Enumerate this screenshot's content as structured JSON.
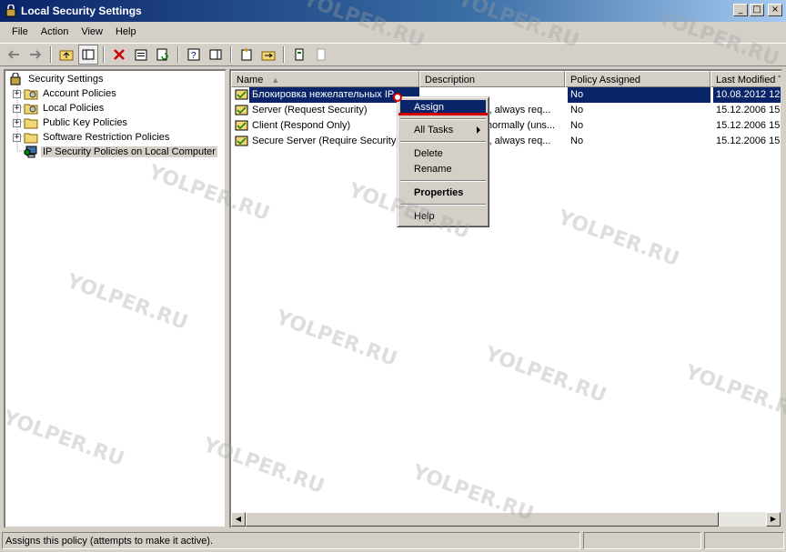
{
  "window": {
    "title": "Local Security Settings"
  },
  "menu": [
    {
      "label": "File",
      "key": "F"
    },
    {
      "label": "Action",
      "key": "A"
    },
    {
      "label": "View",
      "key": "V"
    },
    {
      "label": "Help",
      "key": "H"
    }
  ],
  "tree": {
    "root": "Security Settings",
    "items": [
      "Account Policies",
      "Local Policies",
      "Public Key Policies",
      "Software Restriction Policies",
      "IP Security Policies on Local Computer"
    ]
  },
  "columns": [
    "Name",
    "Description",
    "Policy Assigned",
    "Last Modified T"
  ],
  "rows": [
    {
      "name": "Блокировка нежелательных IP",
      "description": "",
      "assigned": "No",
      "modified": "10.08.2012 12"
    },
    {
      "name": "Server (Request Security)",
      "description": "For all IP traffic, always req...",
      "assigned": "No",
      "modified": "15.12.2006 15"
    },
    {
      "name": "Client (Respond Only)",
      "description": "Communicate normally (uns...",
      "assigned": "No",
      "modified": "15.12.2006 15"
    },
    {
      "name": "Secure Server (Require Security)",
      "description": "For all IP traffic, always req...",
      "assigned": "No",
      "modified": "15.12.2006 15"
    }
  ],
  "context_menu": {
    "assign": "Assign",
    "all_tasks": "All Tasks",
    "delete": "Delete",
    "rename": "Rename",
    "properties": "Properties",
    "help": "Help"
  },
  "status": {
    "text": "Assigns this policy (attempts to make it active)."
  },
  "watermark": "YOLPER.RU",
  "colors": {
    "selection": "#0a246a",
    "highlight": "#d40000",
    "chrome": "#d4d0c8"
  }
}
